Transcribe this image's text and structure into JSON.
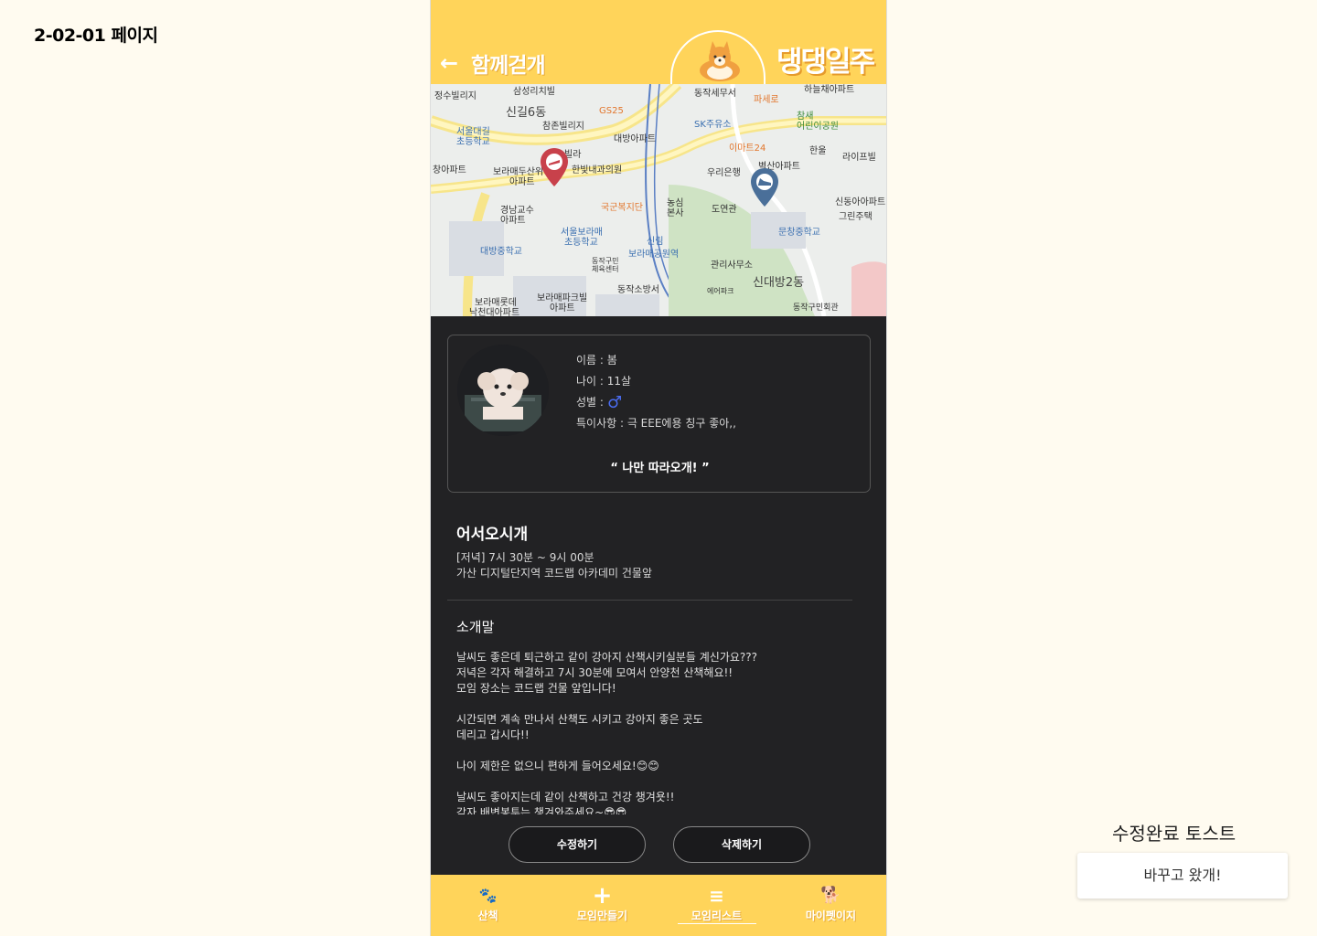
{
  "page_label": "2-02-01 페이지",
  "header": {
    "back_icon": "arrow-left-icon",
    "title": "함께걷개",
    "logo_icon": "corgi-dog-logo",
    "brand": "댕댕일주",
    "color": "#ffd45a"
  },
  "map": {
    "labels": {
      "jeongsu": "정수빌리지",
      "samsung": "삼성리치빌",
      "dongjak_tax": "동작세무서",
      "haneul": "하늘채아파트",
      "sinil6": "신길6동",
      "gs25": "GS25",
      "paseore": "파세로",
      "chamjon": "참존빌리지",
      "sk": "SK주유소",
      "chamsae": "참새",
      "chamsae2": "어린이공원",
      "seouldaerim": "서울대길",
      "seouldaerim2": "초등학교",
      "daebang_apt": "대방아파트",
      "emart24": "이마트24",
      "hanul": "한울",
      "life": "라이프빌",
      "villa": "빌라",
      "changapt": "창아파트",
      "boramae_apt": "보라매두산위",
      "boramae_apt2": "아파트",
      "hanbit": "한빛내과의원",
      "woori": "우리은행",
      "byeoksan": "벽산아파트",
      "nongsim": "농심",
      "nongsim2": "본사",
      "gukgun": "국군복지단",
      "gyeongnam": "경남교수",
      "gyeongnam2": "아파트",
      "doyeon": "도연관",
      "sindong": "신동아아파트",
      "green": "그린주택",
      "seoulboramae": "서울보라매",
      "seoulboramae2": "초등학교",
      "munchang": "문창중학교",
      "daebang_mid": "대방중학교",
      "sinrim": "신림",
      "boramae_park": "보라매공원역",
      "dongjak_gym": "동작구민",
      "dongjak_gym2": "체육센터",
      "office": "관리사무소",
      "sindaebang2": "신대방2동",
      "dongjak_fire": "동작소방서",
      "airpark": "에어파크",
      "boramae_rot": "보라매롯데",
      "boramae_rot2": "낙천대아파트",
      "boramae_park_apt": "보라매파크빌",
      "boramae_park_apt2": "아파트",
      "dongjak_hall": "동작구민회관"
    },
    "start_pin_icon": "start-marker-pin",
    "end_pin_icon": "shoe-marker-pin"
  },
  "profile": {
    "name_label": "이름 : 봄",
    "age_label": "나이 : 11살",
    "gender_label": "성별 :",
    "gender_symbol": "♂",
    "note_label": "특이사항 :  극 EEE에용 칭구 좋아,,",
    "quote": "“ 나만 따라오개! ”"
  },
  "meeting": {
    "title": "어서오시개",
    "time": "[저녁] 7시 30분 ~ 9시 00분",
    "place": "가산 디지털단지역 코드랩 아카데미 건물앞",
    "intro_title": "소개말",
    "intro_body": "날씨도 좋은데 퇴근하고 같이 강아지 산책시키실분들 계신가요???\n저녁은 각자 해결하고 7시 30분에 모여서 안양천 산책해요!!\n모임 장소는 코드랩 건물 앞입니다!\n\n시간되면 계속 만나서 산책도 시키고 강아지 좋은 곳도\n데리고 갑시다!!\n\n나이 제한은 없으니 편하게 들어오세요!😊😊\n\n날씨도 좋아지는데 같이 산책하고 건강 챙겨욧!!\n각자 배변봉투는 챙겨와주세요~😎😎"
  },
  "buttons": {
    "edit": "수정하기",
    "delete": "삭제하기"
  },
  "nav": [
    {
      "icon": "paw-icon",
      "glyph": "🐾",
      "label": "산책"
    },
    {
      "icon": "plus-icon",
      "glyph": "+",
      "label": "모임만들기"
    },
    {
      "icon": "list-icon",
      "glyph": "≡",
      "label": "모임리스트",
      "active": true
    },
    {
      "icon": "dog-icon",
      "glyph": "🐕",
      "label": "마이펫이지"
    }
  ],
  "toast": {
    "title": "수정완료 토스트",
    "message": "바꾸고 왔개!"
  }
}
